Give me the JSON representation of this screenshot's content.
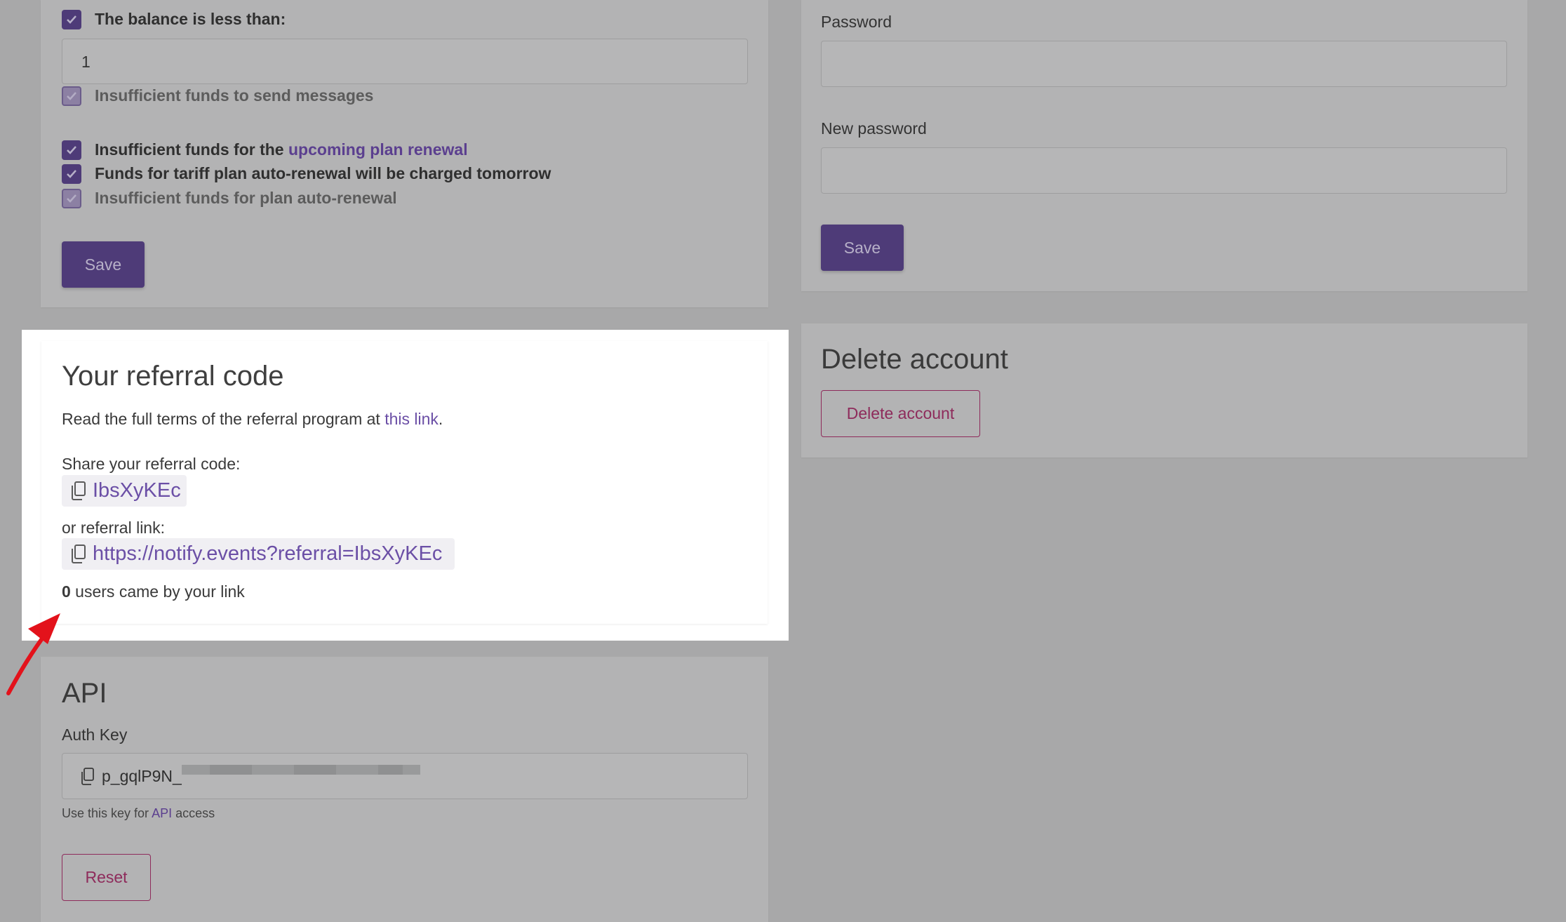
{
  "notifications": {
    "balance_label": "The balance is less than:",
    "balance_value": "1",
    "insufficient_send": "Insufficient funds to send messages",
    "renewal_prefix": "Insufficient funds for the ",
    "renewal_link": "upcoming plan renewal",
    "charged_tomorrow": "Funds for tariff plan auto-renewal will be charged tomorrow",
    "insufficient_auto": "Insufficient funds for plan auto-renewal",
    "save_label": "Save"
  },
  "password": {
    "password_label": "Password",
    "password_value": "",
    "new_password_label": "New password",
    "new_password_value": "",
    "save_label": "Save"
  },
  "delete": {
    "title": "Delete account",
    "button_label": "Delete account"
  },
  "referral": {
    "title": "Your referral code",
    "terms_prefix": "Read the full terms of the referral program at ",
    "terms_link": "this link",
    "terms_suffix": ".",
    "share_label": "Share your referral code:",
    "code": "IbsXyKEc",
    "or_link_label": "or referral link:",
    "link": "https://notify.events?referral=IbsXyKEc",
    "users_count": "0",
    "users_suffix": " users came by your link"
  },
  "api": {
    "title": "API",
    "auth_key_label": "Auth Key",
    "auth_key_visible": "p_gqlP9N_",
    "note_prefix": "Use this key for ",
    "note_link": "API",
    "note_suffix": " access",
    "reset_label": "Reset"
  },
  "colors": {
    "accent": "#4e3b78",
    "link": "#6b4fa6",
    "danger": "#8e2b5b",
    "overlay_bg": "#a8a8a9",
    "arrow": "#e3121b"
  }
}
